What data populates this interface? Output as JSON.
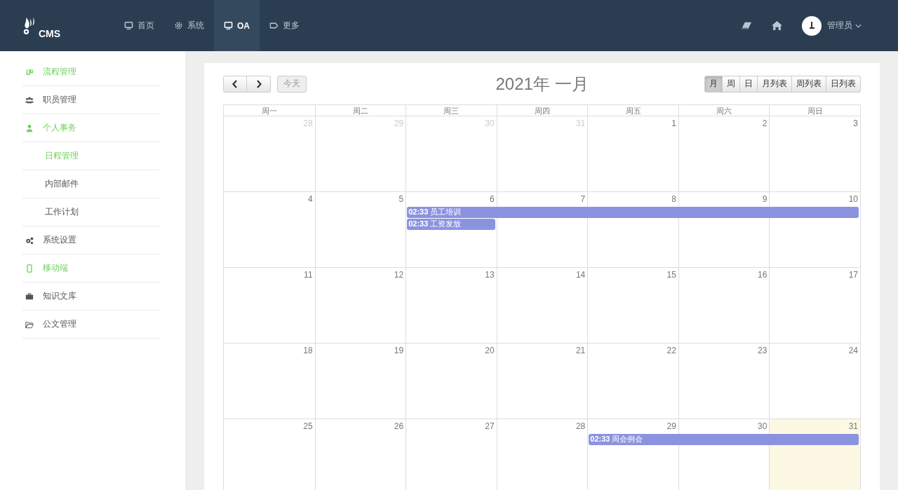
{
  "header": {
    "logo_text": "CMS",
    "nav": [
      {
        "label": "首页",
        "selected": false
      },
      {
        "label": "系统",
        "selected": false
      },
      {
        "label": "OA",
        "selected": true
      },
      {
        "label": "更多",
        "selected": false
      }
    ],
    "user": {
      "name": "管理员"
    }
  },
  "sidebar": {
    "items": [
      {
        "label": "流程管理",
        "active": true
      },
      {
        "label": "职员管理",
        "active": false
      },
      {
        "label": "个人事务",
        "active": true,
        "children": [
          {
            "label": "日程管理",
            "active": true
          },
          {
            "label": "内部邮件",
            "active": false
          },
          {
            "label": "工作计划",
            "active": false
          }
        ]
      },
      {
        "label": "系统设置",
        "active": false
      },
      {
        "label": "移动端",
        "active": true
      },
      {
        "label": "知识文库",
        "active": false
      },
      {
        "label": "公文管理",
        "active": false
      }
    ]
  },
  "calendar": {
    "title": "2021年 一月",
    "today_button": "今天",
    "views": [
      {
        "label": "月",
        "selected": true
      },
      {
        "label": "周",
        "selected": false
      },
      {
        "label": "日",
        "selected": false
      },
      {
        "label": "月列表",
        "selected": false
      },
      {
        "label": "周列表",
        "selected": false
      },
      {
        "label": "日列表",
        "selected": false
      }
    ],
    "weekdays": [
      "周一",
      "周二",
      "周三",
      "周四",
      "周五",
      "周六",
      "周日"
    ],
    "weeks": [
      {
        "days": [
          {
            "n": "28",
            "muted": true,
            "today": false
          },
          {
            "n": "29",
            "muted": true,
            "today": false
          },
          {
            "n": "30",
            "muted": true,
            "today": false
          },
          {
            "n": "31",
            "muted": true,
            "today": false
          },
          {
            "n": "1",
            "muted": false,
            "today": false
          },
          {
            "n": "2",
            "muted": false,
            "today": false
          },
          {
            "n": "3",
            "muted": false,
            "today": false
          }
        ]
      },
      {
        "days": [
          {
            "n": "4",
            "muted": false,
            "today": false
          },
          {
            "n": "5",
            "muted": false,
            "today": false
          },
          {
            "n": "6",
            "muted": false,
            "today": false,
            "events": [
              {
                "time": "02:33",
                "title": "员工培训",
                "continues": true
              },
              {
                "time": "02:33",
                "title": "工资发放",
                "continues": false
              }
            ]
          },
          {
            "n": "7",
            "muted": false,
            "today": false
          },
          {
            "n": "8",
            "muted": false,
            "today": false
          },
          {
            "n": "9",
            "muted": false,
            "today": false
          },
          {
            "n": "10",
            "muted": false,
            "today": false
          }
        ]
      },
      {
        "days": [
          {
            "n": "11",
            "muted": false,
            "today": false
          },
          {
            "n": "12",
            "muted": false,
            "today": false
          },
          {
            "n": "13",
            "muted": false,
            "today": false
          },
          {
            "n": "14",
            "muted": false,
            "today": false
          },
          {
            "n": "15",
            "muted": false,
            "today": false
          },
          {
            "n": "16",
            "muted": false,
            "today": false
          },
          {
            "n": "17",
            "muted": false,
            "today": false
          }
        ]
      },
      {
        "days": [
          {
            "n": "18",
            "muted": false,
            "today": false
          },
          {
            "n": "19",
            "muted": false,
            "today": false
          },
          {
            "n": "20",
            "muted": false,
            "today": false
          },
          {
            "n": "21",
            "muted": false,
            "today": false
          },
          {
            "n": "22",
            "muted": false,
            "today": false
          },
          {
            "n": "23",
            "muted": false,
            "today": false
          },
          {
            "n": "24",
            "muted": false,
            "today": false
          }
        ]
      },
      {
        "days": [
          {
            "n": "25",
            "muted": false,
            "today": false
          },
          {
            "n": "26",
            "muted": false,
            "today": false
          },
          {
            "n": "27",
            "muted": false,
            "today": false
          },
          {
            "n": "28",
            "muted": false,
            "today": false
          },
          {
            "n": "29",
            "muted": false,
            "today": false,
            "events": [
              {
                "time": "02:33",
                "title": "周会例会",
                "continues": true
              }
            ]
          },
          {
            "n": "30",
            "muted": false,
            "today": false
          },
          {
            "n": "31",
            "muted": false,
            "today": true
          }
        ]
      }
    ]
  }
}
